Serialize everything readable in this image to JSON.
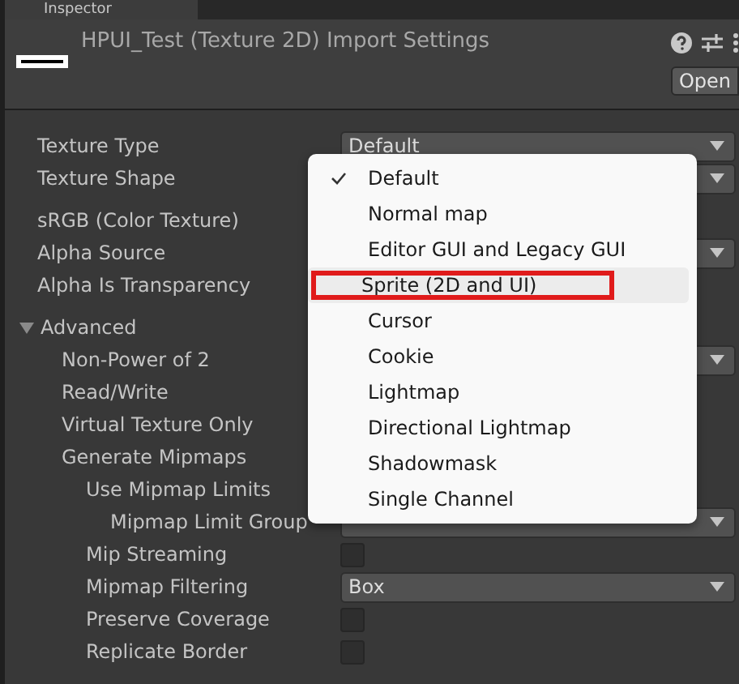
{
  "tab": {
    "title": "Inspector"
  },
  "header": {
    "title": "HPUI_Test (Texture 2D) Import Settings",
    "open_button": "Open"
  },
  "sections": [
    {
      "rows": [
        {
          "label": "Texture Type",
          "kind": "dropdown",
          "value": "Default"
        },
        {
          "label": "Texture Shape",
          "kind": "dropdown"
        }
      ]
    },
    {
      "rows": [
        {
          "label": "sRGB (Color Texture)",
          "kind": "hidden"
        },
        {
          "label": "Alpha Source",
          "kind": "dropdown"
        },
        {
          "label": "Alpha Is Transparency",
          "kind": "hidden"
        }
      ]
    },
    {
      "foldout": {
        "label": "Advanced",
        "expanded": true
      },
      "rows": [
        {
          "label": "Non-Power of 2",
          "kind": "dropdown"
        },
        {
          "label": "Read/Write",
          "kind": "hidden"
        },
        {
          "label": "Virtual Texture Only",
          "kind": "hidden"
        },
        {
          "label": "Generate Mipmaps",
          "kind": "hidden",
          "children": [
            {
              "label": "Use Mipmap Limits",
              "kind": "hidden",
              "children": [
                {
                  "label": "Mipmap Limit Group",
                  "kind": "dropdown"
                }
              ]
            },
            {
              "label": "Mip Streaming",
              "kind": "checkbox",
              "checked": false
            },
            {
              "label": "Mipmap Filtering",
              "kind": "dropdown",
              "value": "Box"
            },
            {
              "label": "Preserve Coverage",
              "kind": "checkbox",
              "checked": false
            },
            {
              "label": "Replicate Border",
              "kind": "checkbox",
              "checked": false
            }
          ]
        }
      ]
    }
  ],
  "menu": {
    "items": [
      {
        "label": "Default",
        "selected": true,
        "hovered": false,
        "outlined": false
      },
      {
        "label": "Normal map",
        "selected": false,
        "hovered": false,
        "outlined": false
      },
      {
        "label": "Editor GUI and Legacy GUI",
        "selected": false,
        "hovered": false,
        "outlined": false
      },
      {
        "label": "Sprite (2D and UI)",
        "selected": false,
        "hovered": true,
        "outlined": true
      },
      {
        "label": "Cursor",
        "selected": false,
        "hovered": false,
        "outlined": false
      },
      {
        "label": "Cookie",
        "selected": false,
        "hovered": false,
        "outlined": false
      },
      {
        "label": "Lightmap",
        "selected": false,
        "hovered": false,
        "outlined": false
      },
      {
        "label": "Directional Lightmap",
        "selected": false,
        "hovered": false,
        "outlined": false
      },
      {
        "label": "Shadowmask",
        "selected": false,
        "hovered": false,
        "outlined": false
      },
      {
        "label": "Single Channel",
        "selected": false,
        "hovered": false,
        "outlined": false
      }
    ]
  }
}
